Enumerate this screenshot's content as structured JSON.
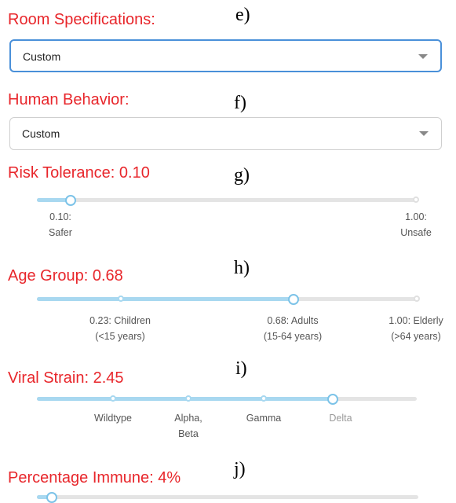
{
  "room": {
    "title": "Room Specifications:",
    "letter": "e)",
    "value": "Custom"
  },
  "behavior": {
    "title": "Human Behavior:",
    "letter": "f)",
    "value": "Custom"
  },
  "risk": {
    "title": "Risk Tolerance: 0.10",
    "letter": "g)",
    "level": 0.1,
    "marks": [
      {
        "line1": "0.10:",
        "line2": "Safer"
      },
      {
        "line1": "1.00:",
        "line2": "Unsafe"
      }
    ]
  },
  "age": {
    "title": "Age Group: 0.68",
    "letter": "h)",
    "level": 0.68,
    "marks": [
      {
        "line1": "0.23: Children",
        "line2": "(<15 years)"
      },
      {
        "line1": "0.68: Adults",
        "line2": "(15-64 years)"
      },
      {
        "line1": "1.00: Elderly",
        "line2": "(>64 years)"
      }
    ]
  },
  "viral": {
    "title": "Viral Strain: 2.45",
    "letter": "i)",
    "marks": [
      {
        "line1": "Wildtype",
        "line2": ""
      },
      {
        "line1": "Alpha,",
        "line2": "Beta"
      },
      {
        "line1": "Gamma",
        "line2": ""
      },
      {
        "line1": "Delta",
        "line2": ""
      }
    ],
    "selected": "Delta"
  },
  "immune": {
    "title": "Percentage Immune: 4%",
    "letter": "j)",
    "level": 0.04
  },
  "colors": {
    "accent": "#e8262b",
    "slider_fill": "#a8d8f0",
    "slider_handle": "#7cc3e8",
    "focus_border": "#4a90d9"
  }
}
